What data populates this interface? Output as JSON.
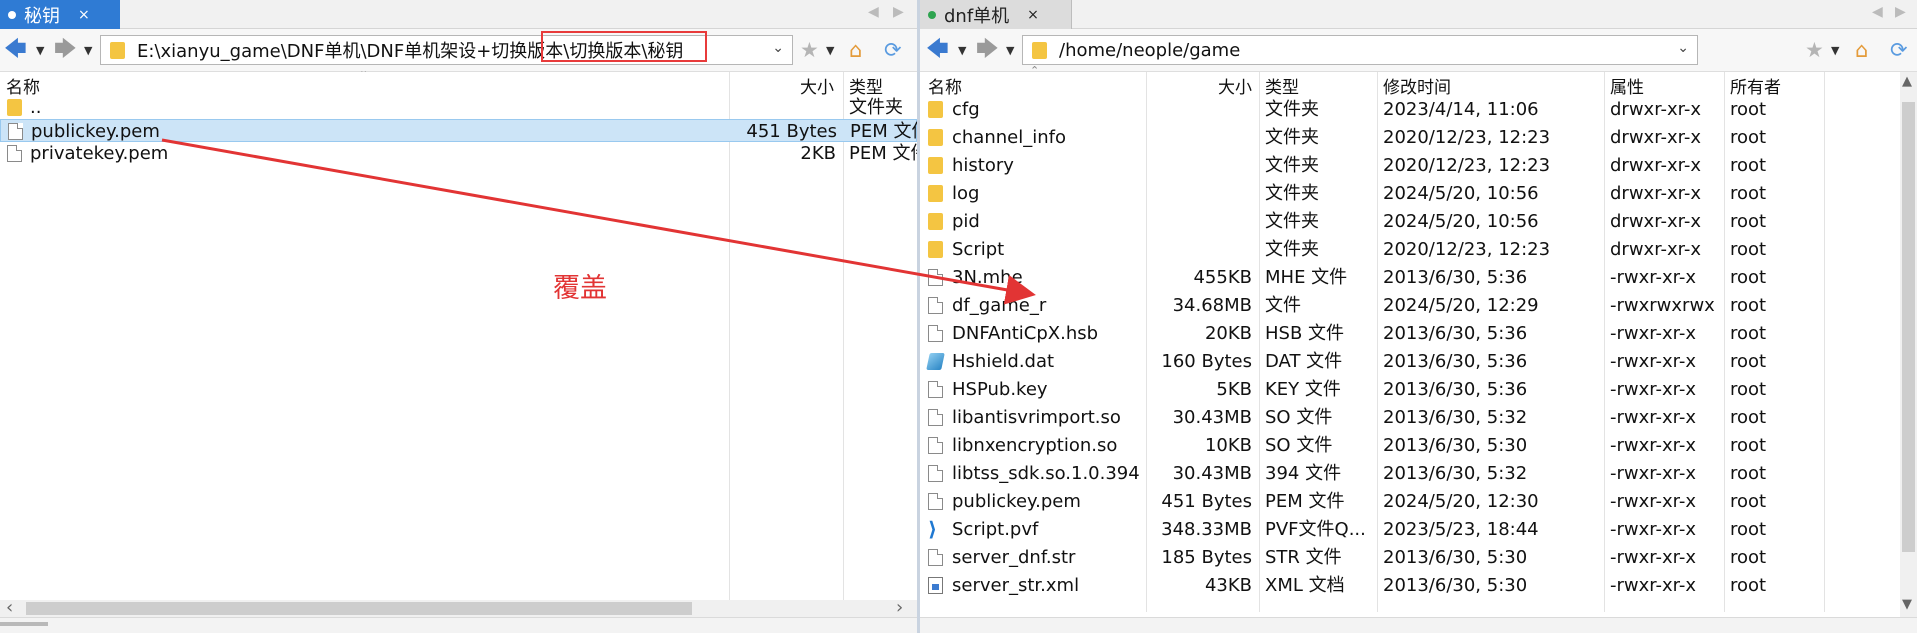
{
  "left": {
    "tab": {
      "label": "秘钥",
      "close": "×"
    },
    "address": "E:\\xianyu_game\\DNF单机\\DNF单机架设+切换版本\\切换版本\\秘钥",
    "columns": {
      "name": "名称",
      "size": "大小",
      "type": "类型"
    },
    "rows": [
      {
        "icon": "folder",
        "name": "..",
        "size": "",
        "type": "文件夹"
      },
      {
        "icon": "file",
        "name": "publickey.pem",
        "size": "451 Bytes",
        "type": "PEM 文件"
      },
      {
        "icon": "file",
        "name": "privatekey.pem",
        "size": "2KB",
        "type": "PEM 文件"
      }
    ],
    "selected_row": 1
  },
  "right": {
    "tab": {
      "label": "dnf单机",
      "close": "×"
    },
    "address": "/home/neople/game",
    "columns": {
      "name": "名称",
      "size": "大小",
      "type": "类型",
      "modified": "修改时间",
      "attrs": "属性",
      "owner": "所有者"
    },
    "rows": [
      {
        "icon": "folder",
        "name": "cfg",
        "size": "",
        "type": "文件夹",
        "modified": "2023/4/14, 11:06",
        "attrs": "drwxr-xr-x",
        "owner": "root"
      },
      {
        "icon": "folder",
        "name": "channel_info",
        "size": "",
        "type": "文件夹",
        "modified": "2020/12/23, 12:23",
        "attrs": "drwxr-xr-x",
        "owner": "root"
      },
      {
        "icon": "folder",
        "name": "history",
        "size": "",
        "type": "文件夹",
        "modified": "2020/12/23, 12:23",
        "attrs": "drwxr-xr-x",
        "owner": "root"
      },
      {
        "icon": "folder",
        "name": "log",
        "size": "",
        "type": "文件夹",
        "modified": "2024/5/20, 10:56",
        "attrs": "drwxr-xr-x",
        "owner": "root"
      },
      {
        "icon": "folder",
        "name": "pid",
        "size": "",
        "type": "文件夹",
        "modified": "2024/5/20, 10:56",
        "attrs": "drwxr-xr-x",
        "owner": "root"
      },
      {
        "icon": "folder",
        "name": "Script",
        "size": "",
        "type": "文件夹",
        "modified": "2020/12/23, 12:23",
        "attrs": "drwxr-xr-x",
        "owner": "root"
      },
      {
        "icon": "file",
        "name": "3N.mhe",
        "size": "455KB",
        "type": "MHE 文件",
        "modified": "2013/6/30, 5:36",
        "attrs": "-rwxr-xr-x",
        "owner": "root"
      },
      {
        "icon": "file",
        "name": "df_game_r",
        "size": "34.68MB",
        "type": "文件",
        "modified": "2024/5/20, 12:29",
        "attrs": "-rwxrwxrwx",
        "owner": "root"
      },
      {
        "icon": "file",
        "name": "DNFAntiCpX.hsb",
        "size": "20KB",
        "type": "HSB 文件",
        "modified": "2013/6/30, 5:36",
        "attrs": "-rwxr-xr-x",
        "owner": "root"
      },
      {
        "icon": "dat",
        "name": "Hshield.dat",
        "size": "160 Bytes",
        "type": "DAT 文件",
        "modified": "2013/6/30, 5:36",
        "attrs": "-rwxr-xr-x",
        "owner": "root"
      },
      {
        "icon": "file",
        "name": "HSPub.key",
        "size": "5KB",
        "type": "KEY 文件",
        "modified": "2013/6/30, 5:36",
        "attrs": "-rwxr-xr-x",
        "owner": "root"
      },
      {
        "icon": "file",
        "name": "libantisvrimport.so",
        "size": "30.43MB",
        "type": "SO 文件",
        "modified": "2013/6/30, 5:32",
        "attrs": "-rwxr-xr-x",
        "owner": "root"
      },
      {
        "icon": "file",
        "name": "libnxencryption.so",
        "size": "10KB",
        "type": "SO 文件",
        "modified": "2013/6/30, 5:30",
        "attrs": "-rwxr-xr-x",
        "owner": "root"
      },
      {
        "icon": "file",
        "name": "libtss_sdk.so.1.0.394",
        "size": "30.43MB",
        "type": "394 文件",
        "modified": "2013/6/30, 5:32",
        "attrs": "-rwxr-xr-x",
        "owner": "root"
      },
      {
        "icon": "file",
        "name": "publickey.pem",
        "size": "451 Bytes",
        "type": "PEM 文件",
        "modified": "2024/5/20, 12:30",
        "attrs": "-rwxr-xr-x",
        "owner": "root"
      },
      {
        "icon": "vsc",
        "name": "Script.pvf",
        "size": "348.33MB",
        "type": "PVF文件Q...",
        "modified": "2023/5/23, 18:44",
        "attrs": "-rwxr-xr-x",
        "owner": "root"
      },
      {
        "icon": "file",
        "name": "server_dnf.str",
        "size": "185 Bytes",
        "type": "STR 文件",
        "modified": "2013/6/30, 5:30",
        "attrs": "-rwxr-xr-x",
        "owner": "root"
      },
      {
        "icon": "xml",
        "name": "server_str.xml",
        "size": "43KB",
        "type": "XML 文档",
        "modified": "2013/6/30, 5:30",
        "attrs": "-rwxr-xr-x",
        "owner": "root"
      }
    ]
  },
  "annotation": {
    "text": "覆盖",
    "color": "#e23434"
  },
  "colors": {
    "accent_tab": "#2f7bd4",
    "selection": "#cce4f7",
    "folder": "#f4c542",
    "annotation_red": "#e83b3b"
  }
}
